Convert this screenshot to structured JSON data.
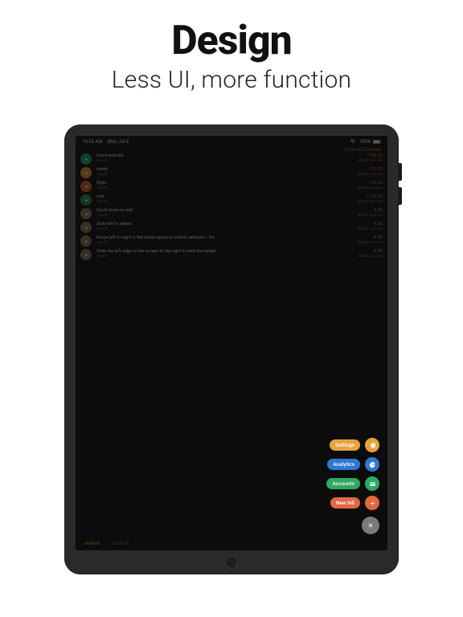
{
  "marketing": {
    "headline": "Design",
    "subhead": "Less UI, more function"
  },
  "status": {
    "time": "10:55 AM",
    "date": "Mon Jul 8",
    "battery": "100%"
  },
  "header": {
    "balance_label": "Income/Expense"
  },
  "rows": [
    {
      "title": "communicate",
      "sub": "myself",
      "amount": "-100.00",
      "amount_color": "#b85c3a",
      "account": "default account",
      "color": "#2e8b57"
    },
    {
      "title": "street",
      "sub": "myself",
      "amount": "-100.00",
      "amount_color": "#b85c3a",
      "account": "default account",
      "color": "#c77c3a"
    },
    {
      "title": "flight",
      "sub": "myself",
      "amount": "-100.00",
      "amount_color": "#b85c3a",
      "account": "default account",
      "color": "#b85c3a"
    },
    {
      "title": "rent",
      "sub": "myself",
      "amount": "+100.00",
      "amount_color": "#3a8f5b",
      "account": "default account",
      "color": "#2e7f4f"
    },
    {
      "title": "Scroll down to edit",
      "sub": "myself",
      "amount": "0.00",
      "amount_color": "#8a8a8a",
      "account": "default account",
      "color": "#7a6a4f"
    },
    {
      "title": "Slide left to delete",
      "sub": "myself",
      "amount": "0.00",
      "amount_color": "#8a8a8a",
      "account": "default account",
      "color": "#7a6a4f"
    },
    {
      "title": "Swipe left or right in the blank space to switch calendar / list",
      "sub": "myself",
      "amount": "0.00",
      "amount_color": "#8a8a8a",
      "account": "default account",
      "color": "#7a6a4f"
    },
    {
      "title": "Slide the left edge of the screen to the right to view the ledger",
      "sub": "myself",
      "amount": "0.00",
      "amount_color": "#8a8a8a",
      "account": "default account",
      "color": "#7a6a4f"
    }
  ],
  "bottom": {
    "left": "‹ default...",
    "mid": "2019-07"
  },
  "fab": {
    "items": [
      {
        "label": "Settings",
        "color": "#e8a33c",
        "icon": "gear"
      },
      {
        "label": "Analytics",
        "color": "#2f78d1",
        "icon": "chart"
      },
      {
        "label": "Accounts",
        "color": "#2fa85f",
        "icon": "card"
      },
      {
        "label": "New bill",
        "color": "#e0673e",
        "icon": "plus"
      }
    ],
    "close_color": "#7a7a7a"
  },
  "colors": {
    "gear": "#e8a33c",
    "chart": "#2f78d1",
    "card": "#2fa85f",
    "plus": "#e0673e"
  }
}
